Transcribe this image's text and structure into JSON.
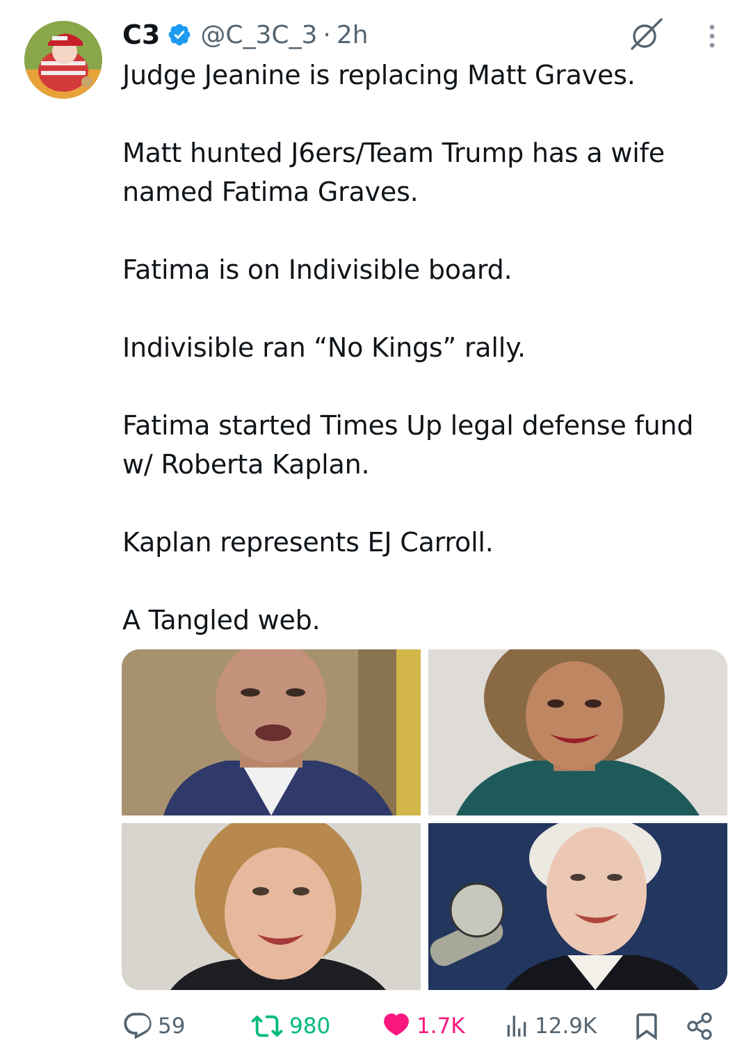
{
  "author": {
    "name": "C3",
    "handle": "@C_3C_3",
    "separator": "·",
    "time": "2h",
    "verified": true,
    "verified_color": "#1d9bf0"
  },
  "tweet": {
    "paragraphs": [
      "Judge Jeanine is replacing Matt Graves.",
      "Matt hunted J6ers/Team Trump has a wife named Fatima Graves.",
      "Fatima is on Indivisible board.",
      "Indivisible ran “No Kings” rally.",
      "Fatima started Times Up legal defense fund w/ Roberta Kaplan.",
      "Kaplan represents EJ Carroll.",
      "A Tangled web."
    ]
  },
  "actions": {
    "replies": "59",
    "reposts": "980",
    "likes": "1.7K",
    "views": "12.9K"
  },
  "colors": {
    "text": "#0f1419",
    "secondary": "#536471",
    "repost_active": "#00ba7c",
    "like_active": "#f91880"
  },
  "icons": {
    "verified": "verified-badge-icon",
    "grok": "grok-icon",
    "more": "more-vertical-icon",
    "reply": "reply-icon",
    "repost": "repost-icon",
    "like": "heart-icon",
    "views": "views-icon",
    "bookmark": "bookmark-icon",
    "share": "share-icon"
  }
}
